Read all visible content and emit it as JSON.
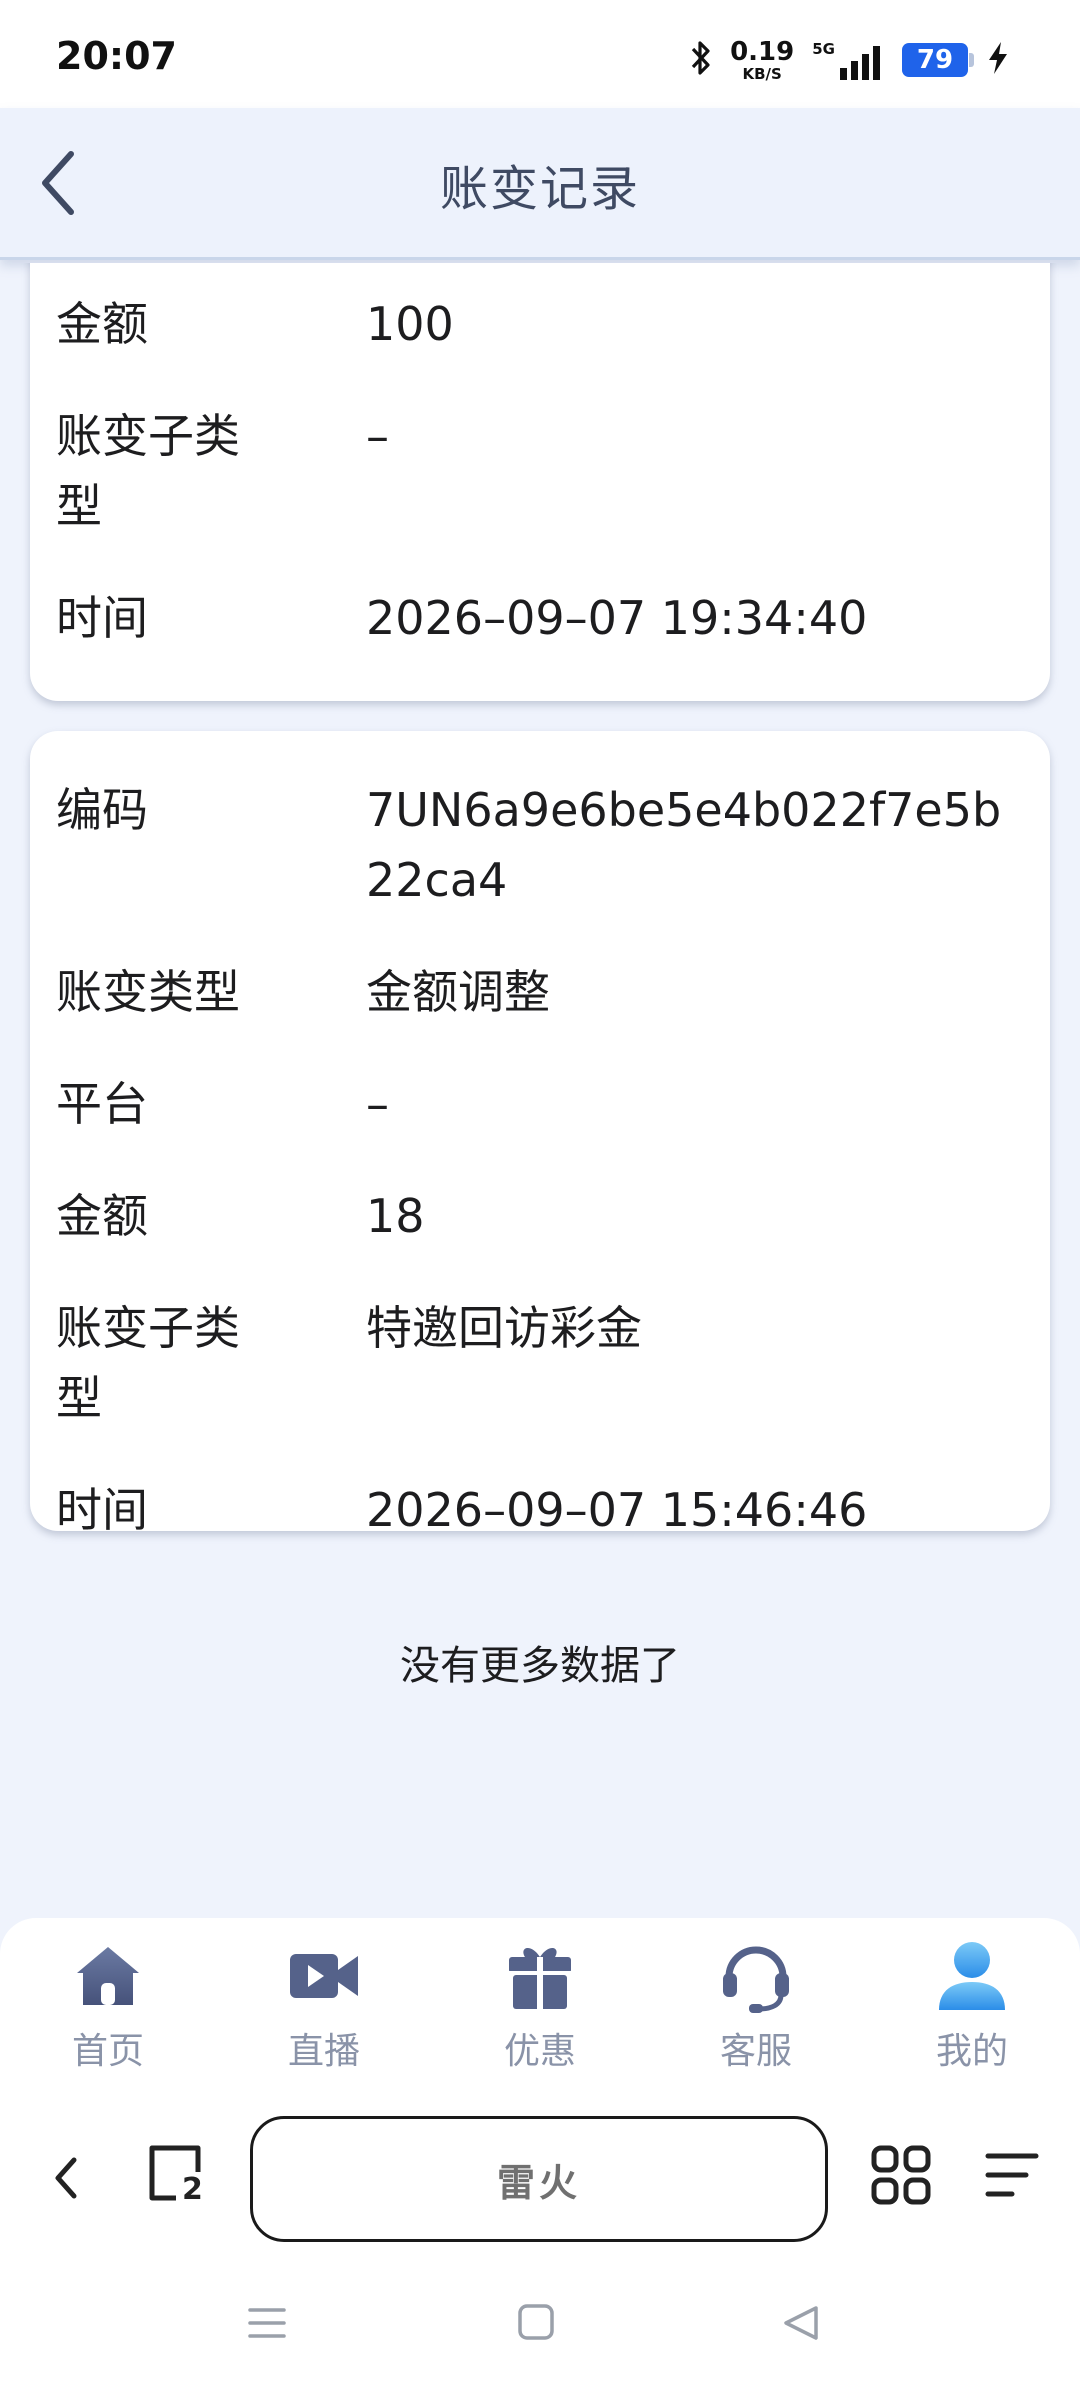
{
  "status_bar": {
    "time": "20:07",
    "net_speed": "0.19",
    "net_unit": "KB/S",
    "network": "5G",
    "battery": "79",
    "icons": [
      "bluetooth-icon",
      "signal-icon",
      "battery-icon",
      "charging-icon"
    ]
  },
  "header": {
    "title": "账变记录",
    "back_icon": "chevron-left-icon"
  },
  "records": [
    {
      "rows": [
        {
          "key": "金额",
          "value": "100"
        },
        {
          "key": "账变子类型",
          "value": "–"
        },
        {
          "key": "时间",
          "value": "2026–09–07 19:34:40"
        }
      ]
    },
    {
      "rows": [
        {
          "key": "编码",
          "value": "7UN6a9e6be5e4b022f7e5b22ca4"
        },
        {
          "key": "账变类型",
          "value": "金额调整"
        },
        {
          "key": "平台",
          "value": "–"
        },
        {
          "key": "金额",
          "value": "18"
        },
        {
          "key": "账变子类型",
          "value": "特邀回访彩金"
        },
        {
          "key": "时间",
          "value": "2026–09–07 15:46:46"
        }
      ]
    }
  ],
  "no_more_text": "没有更多数据了",
  "tabbar": {
    "items": [
      {
        "label": "首页",
        "icon": "home-icon"
      },
      {
        "label": "直播",
        "icon": "video-camera-icon"
      },
      {
        "label": "优惠",
        "icon": "gift-icon"
      },
      {
        "label": "客服",
        "icon": "headset-icon"
      },
      {
        "label": "我的",
        "icon": "user-icon",
        "active": true
      }
    ],
    "colors": {
      "inactive_icon": "#4d5a7e",
      "active_icon": "#3aa0f0",
      "label": "#8a93a8"
    }
  },
  "browser_bar": {
    "address_text": "雷火",
    "tab_count": "2"
  },
  "system_nav": {
    "icons": [
      "menu-icon",
      "home-square-icon",
      "back-triangle-icon"
    ]
  }
}
